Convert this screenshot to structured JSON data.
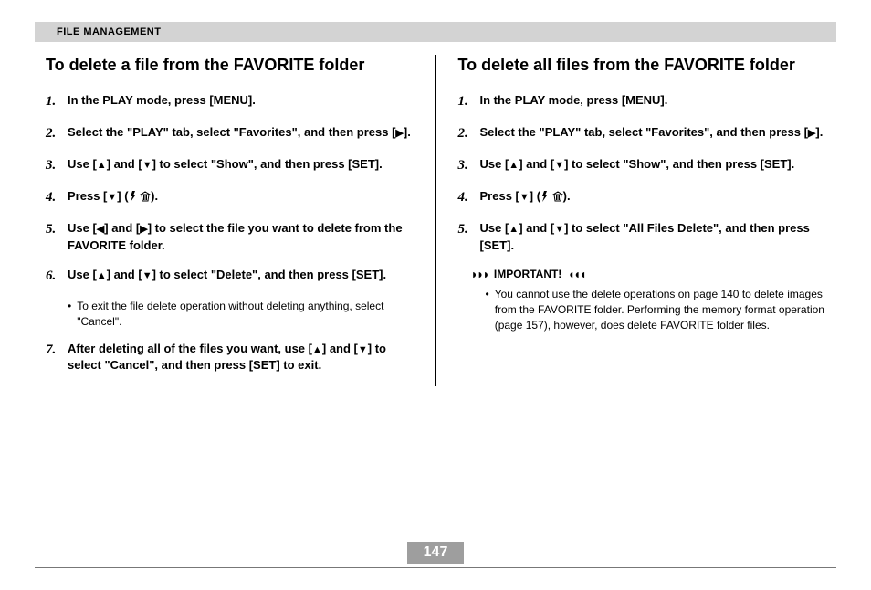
{
  "header": {
    "section": "FILE MANAGEMENT"
  },
  "pageNumber": "147",
  "glyph": {
    "up": "▲",
    "down": "▼",
    "left": "◀",
    "right": "▶"
  },
  "left": {
    "title": "To delete a file from the FAVORITE folder",
    "steps": {
      "s1": "In the PLAY mode, press [MENU].",
      "s2a": "Select the \"PLAY\" tab, select \"Favorites\", and then press [",
      "s2b": "].",
      "s3a": "Use [",
      "s3b": "] and [",
      "s3c": "] to select \"Show\", and then press [SET].",
      "s4a": "Press [",
      "s4b": "] (",
      "s4c": ").",
      "s5a": "Use [",
      "s5b": "] and [",
      "s5c": "] to select the file you want to delete from the FAVORITE folder.",
      "s6a": "Use [",
      "s6b": "] and [",
      "s6c": "] to select \"Delete\", and then press [SET].",
      "s6note": "To exit the file delete operation without deleting anything, select \"Cancel\".",
      "s7a": "After deleting all of the files you want, use [",
      "s7b": "] and [",
      "s7c": "] to select \"Cancel\", and then press [SET] to exit."
    }
  },
  "right": {
    "title": "To delete all files from the FAVORITE folder",
    "steps": {
      "s1": "In the PLAY mode, press [MENU].",
      "s2a": "Select the \"PLAY\" tab, select \"Favorites\", and then press [",
      "s2b": "].",
      "s3a": "Use [",
      "s3b": "] and [",
      "s3c": "] to select \"Show\", and then press [SET].",
      "s4a": "Press [",
      "s4b": "] (",
      "s4c": ").",
      "s5a": "Use [",
      "s5b": "] and [",
      "s5c": "] to select \"All Files Delete\", and then press [SET]."
    },
    "importantLabel": "IMPORTANT!",
    "importantNote": "You cannot use the delete operations on page 140 to delete images from the FAVORITE folder. Performing the memory format operation (page 157), however, does delete FAVORITE folder files."
  }
}
